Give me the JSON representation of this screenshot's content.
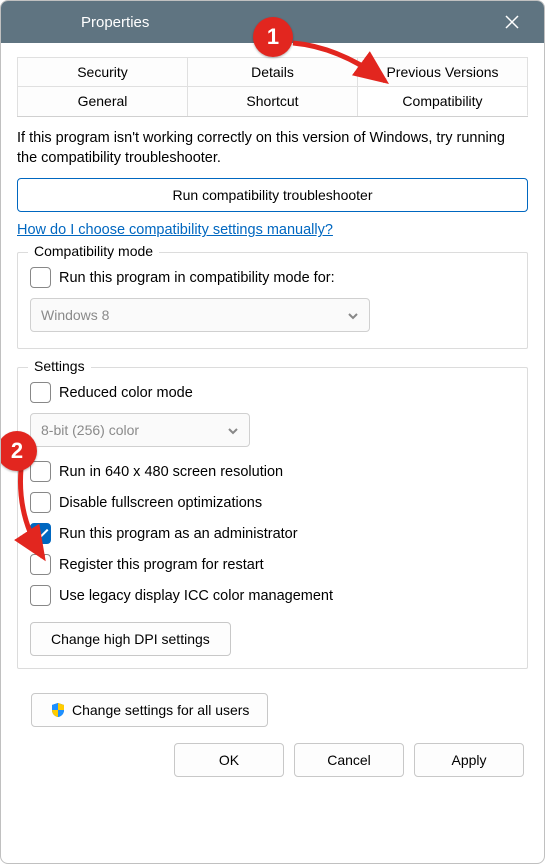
{
  "window": {
    "title": "Properties"
  },
  "tabs": {
    "row1": [
      "Security",
      "Details",
      "Previous Versions"
    ],
    "row2": [
      "General",
      "Shortcut",
      "Compatibility"
    ],
    "active": "Compatibility"
  },
  "intro": "If this program isn't working correctly on this version of Windows, try running the compatibility troubleshooter.",
  "troubleshoot_button": "Run compatibility troubleshooter",
  "help_link": "How do I choose compatibility settings manually?",
  "compat_mode": {
    "title": "Compatibility mode",
    "checkbox": "Run this program in compatibility mode for:",
    "select_value": "Windows 8"
  },
  "settings": {
    "title": "Settings",
    "reduced_color": "Reduced color mode",
    "color_select": "8-bit (256) color",
    "run_640": "Run in 640 x 480 screen resolution",
    "disable_fullscreen": "Disable fullscreen optimizations",
    "run_admin": "Run this program as an administrator",
    "register_restart": "Register this program for restart",
    "legacy_icc": "Use legacy display ICC color management",
    "dpi_button": "Change high DPI settings"
  },
  "all_users_button": "Change settings for all users",
  "footer": {
    "ok": "OK",
    "cancel": "Cancel",
    "apply": "Apply"
  },
  "annotations": {
    "step1": "1",
    "step2": "2"
  }
}
